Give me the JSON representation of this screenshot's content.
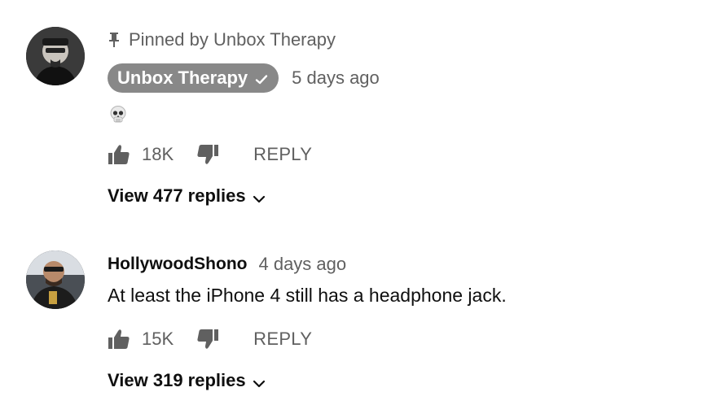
{
  "comments": [
    {
      "pinned_label": "Pinned by Unbox Therapy",
      "author": "Unbox Therapy",
      "time": "5 days ago",
      "content_icon": "skull-emoji",
      "likes": "18K",
      "reply_label": "REPLY",
      "view_replies": "View 477 replies"
    },
    {
      "author": "HollywoodShono",
      "time": "4 days ago",
      "text": "At least the iPhone 4 still has a headphone jack.",
      "likes": "15K",
      "reply_label": "REPLY",
      "view_replies": "View 319 replies"
    }
  ],
  "colors": {
    "badge_bg": "#888888",
    "secondary_text": "#606060",
    "primary_text": "#0f0f0f",
    "icon": "#606060"
  }
}
